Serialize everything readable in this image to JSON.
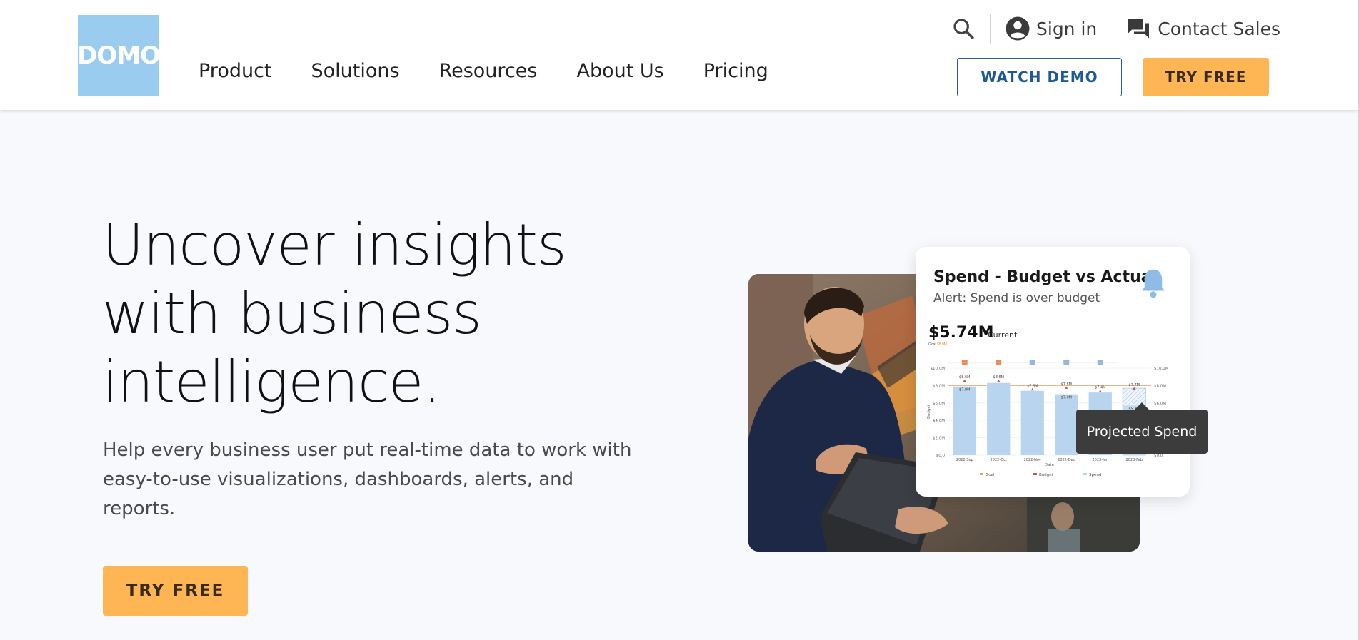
{
  "brand": {
    "logo_text": "DOMO",
    "accent": "#99ccee",
    "cta_color": "#fdb653"
  },
  "nav": {
    "items": [
      {
        "label": "Product"
      },
      {
        "label": "Solutions"
      },
      {
        "label": "Resources"
      },
      {
        "label": "About Us"
      },
      {
        "label": "Pricing"
      }
    ]
  },
  "utility": {
    "search_icon": "search-icon",
    "sign_in": "Sign in",
    "contact_sales": "Contact Sales"
  },
  "header_buttons": {
    "watch_demo": "WATCH DEMO",
    "try_free": "TRY FREE"
  },
  "hero": {
    "title_line1": "Uncover insights",
    "title_line2": "with business",
    "title_line3": "intelligence.",
    "subtitle": "Help every business user put real-time data to work with easy-to-use visualizations, dashboards, alerts, and reports.",
    "cta": "TRY FREE"
  },
  "card": {
    "title": "Spend - Budget vs Actual",
    "alert": "Alert: Spend is over budget",
    "current_value": "$5.74M",
    "current_label": "Current",
    "goal_label": "Goal",
    "goal_value": "$8.0M",
    "tooltip": "Projected Spend"
  },
  "chart_data": {
    "type": "bar",
    "title": "",
    "xlabel": "Date",
    "ylabel": "Budget",
    "categories": [
      "2022-Sep",
      "2022-Oct",
      "2022-Nov",
      "2022-Dec",
      "2023-Jan",
      "2023-Feb"
    ],
    "y_ticks": [
      "$0.0",
      "$2.0M",
      "$4.0M",
      "$6.0M",
      "$8.0M",
      "$10.0M"
    ],
    "ylim": [
      0,
      10
    ],
    "series": [
      {
        "name": "Spend",
        "values": [
          7.9,
          8.3,
          7.4,
          7.0,
          7.2,
          5.7
        ]
      },
      {
        "name": "Budget",
        "values": [
          8.6,
          8.6,
          7.6,
          7.8,
          7.4,
          7.7
        ]
      },
      {
        "name": "Goal",
        "values": [
          8.0,
          8.0,
          8.0,
          8.0,
          8.0,
          8.0
        ]
      }
    ],
    "data_labels_top": [
      "$8.6M",
      "$8.6M",
      "$7.6M",
      "$7.8M",
      "$7.4M",
      "$7.7M"
    ],
    "data_labels_bar": [
      "$7.9M",
      "",
      "",
      "$7.0M",
      "",
      "$5.7M"
    ],
    "legend": [
      "Goal",
      "Budget",
      "Spend"
    ],
    "legend_position": "bottom",
    "projected_last": true,
    "colors": {
      "spend": "#b9d4ef",
      "goal": "#e9a06b",
      "budget": "#c8534a"
    }
  }
}
